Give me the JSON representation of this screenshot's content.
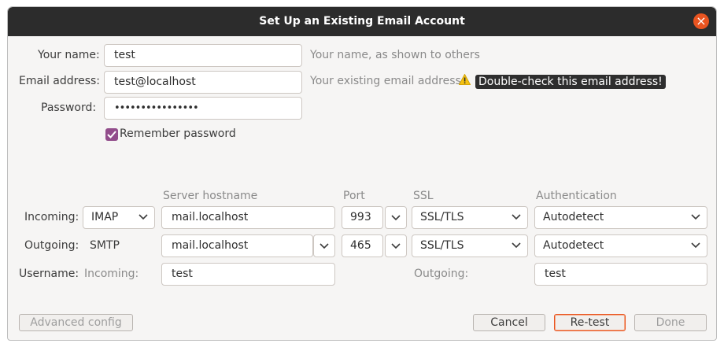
{
  "window": {
    "title": "Set Up an Existing Email Account"
  },
  "form": {
    "name_label": "Your name:",
    "name_value": "test",
    "name_hint": "Your name, as shown to others",
    "email_label": "Email address:",
    "email_value": "test@localhost",
    "email_hint": "Your existing email address",
    "email_warning": "Double-check this email address!",
    "password_label": "Password:",
    "password_value": "••••••••••••••••",
    "remember_label": "Remember password",
    "remember_checked": true
  },
  "server": {
    "headers": {
      "hostname": "Server hostname",
      "port": "Port",
      "ssl": "SSL",
      "auth": "Authentication"
    },
    "incoming": {
      "label": "Incoming:",
      "protocol": "IMAP",
      "hostname": "mail.localhost",
      "port": "993",
      "ssl": "SSL/TLS",
      "auth": "Autodetect"
    },
    "outgoing": {
      "label": "Outgoing:",
      "protocol": "SMTP",
      "hostname": "mail.localhost",
      "port": "465",
      "ssl": "SSL/TLS",
      "auth": "Autodetect"
    },
    "username": {
      "label": "Username:",
      "incoming_label": "Incoming:",
      "incoming_value": "test",
      "outgoing_label": "Outgoing:",
      "outgoing_value": "test"
    }
  },
  "buttons": {
    "advanced": "Advanced config",
    "cancel": "Cancel",
    "retest": "Re-test",
    "done": "Done"
  },
  "colors": {
    "accent": "#e95420",
    "checkbox": "#924d8b",
    "titlebar": "#2c2c2c"
  }
}
